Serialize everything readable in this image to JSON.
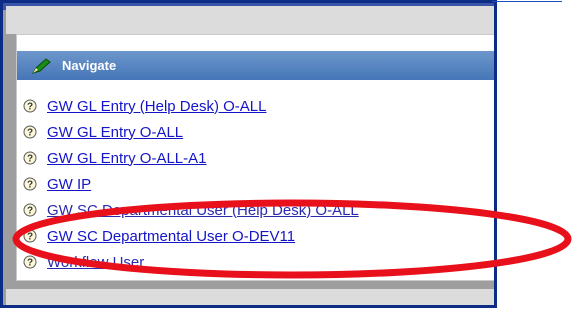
{
  "navigate": {
    "header": "Navigate",
    "items": [
      {
        "label": "GW GL Entry (Help Desk) O-ALL"
      },
      {
        "label": "GW GL Entry O-ALL"
      },
      {
        "label": "GW GL Entry O-ALL-A1"
      },
      {
        "label": "GW IP"
      },
      {
        "label": "GW SC Departmental User (Help Desk) O-ALL"
      },
      {
        "label": "GW SC Departmental User O-DEV11"
      },
      {
        "label": "Workflow User"
      }
    ]
  },
  "icons": {
    "header_icon": "pencil-icon",
    "item_icon": "question-icon"
  },
  "colors": {
    "frame_border": "#0c2c86",
    "header_bg": "#4f7fbf",
    "link": "#1414c8",
    "highlight": "#e8101a"
  }
}
